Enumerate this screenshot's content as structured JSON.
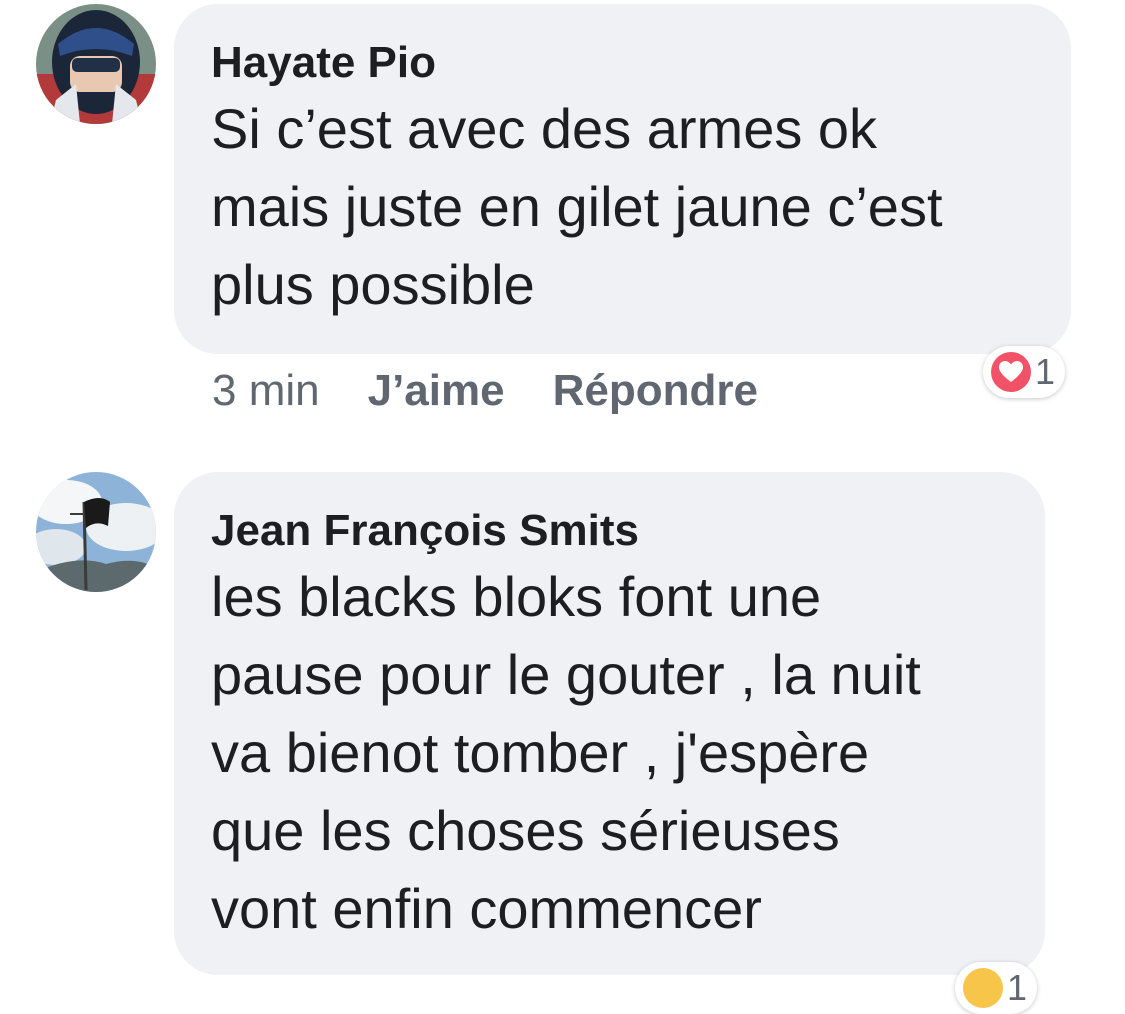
{
  "comments": [
    {
      "author": "Hayate Pio",
      "text": "Si c’est avec des armes ok\nmais juste en gilet jaune c’est\nplus possible",
      "time": "3 min",
      "like_label": "J’aime",
      "reply_label": "Répondre",
      "reaction_icon": "heart-icon",
      "reaction_count": "1",
      "avatar_icon": "helmet-avatar"
    },
    {
      "author": "Jean François Smits",
      "text": "les blacks bloks font une\npause pour le gouter , la nuit\nva bienot tomber , j'espère\nque les choses sérieuses\nvont enfin commencer",
      "reaction_icon": "emoji-icon",
      "reaction_count": "1",
      "avatar_icon": "flag-avatar"
    }
  ],
  "colors": {
    "bubble": "#f0f1f4",
    "text": "#1c1e21",
    "meta": "#606770",
    "heart": "#f25268"
  }
}
